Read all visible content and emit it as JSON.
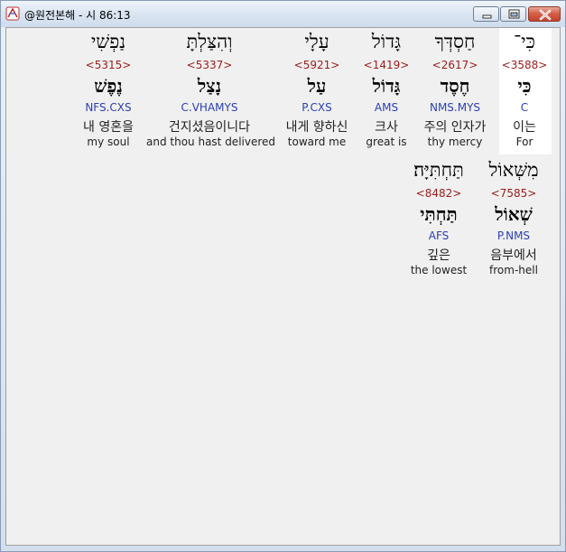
{
  "window": {
    "title": "@원전본해 - 시 86:13"
  },
  "words": [
    {
      "hebrew": "כִּי־",
      "strong": "<3588>",
      "lemma": "כִּי",
      "morph": "C",
      "korean": "이는",
      "english": "For",
      "highlighted": true
    },
    {
      "hebrew": "חַסְדְּךָ",
      "strong": "<2617>",
      "lemma": "חֶסֶד",
      "morph": "NMS.MYS",
      "korean": "주의 인자가",
      "english": "thy mercy",
      "highlighted": false
    },
    {
      "hebrew": "גָּדוֹל",
      "strong": "<1419>",
      "lemma": "גָּדוֹל",
      "morph": "AMS",
      "korean": "크사",
      "english": "great is",
      "highlighted": false
    },
    {
      "hebrew": "עָלָי",
      "strong": "<5921>",
      "lemma": "עַל",
      "morph": "P.CXS",
      "korean": "내게 향하신",
      "english": "toward me",
      "highlighted": false
    },
    {
      "hebrew": "וְהִצַּלְתָּ",
      "strong": "<5337>",
      "lemma": "נָצַל",
      "morph": "C.VHAMYS",
      "korean": "건지셨음이니다",
      "english": "and thou hast delivered",
      "highlighted": false
    },
    {
      "hebrew": "נַפְשִׁי",
      "strong": "<5315>",
      "lemma": "נֶפֶשׁ",
      "morph": "NFS.CXS",
      "korean": "내 영혼을",
      "english": "my soul",
      "highlighted": false
    },
    {
      "hebrew": "מִשְּׁאוֹל",
      "strong": "<7585>",
      "lemma": "שְׁאוֹל",
      "morph": "P.NMS",
      "korean": "음부에서",
      "english": "from-hell",
      "highlighted": false
    },
    {
      "hebrew": "תַּחְתִּיָּה׃",
      "strong": "<8482>",
      "lemma": "תַּחְתִּי",
      "morph": "AFS",
      "korean": "깊은",
      "english": "the lowest",
      "highlighted": false
    }
  ],
  "colors": {
    "strong": "#9b1c1c",
    "morph": "#2b3fb3",
    "highlight": "#ffffff",
    "background": "#f0f0f0"
  }
}
